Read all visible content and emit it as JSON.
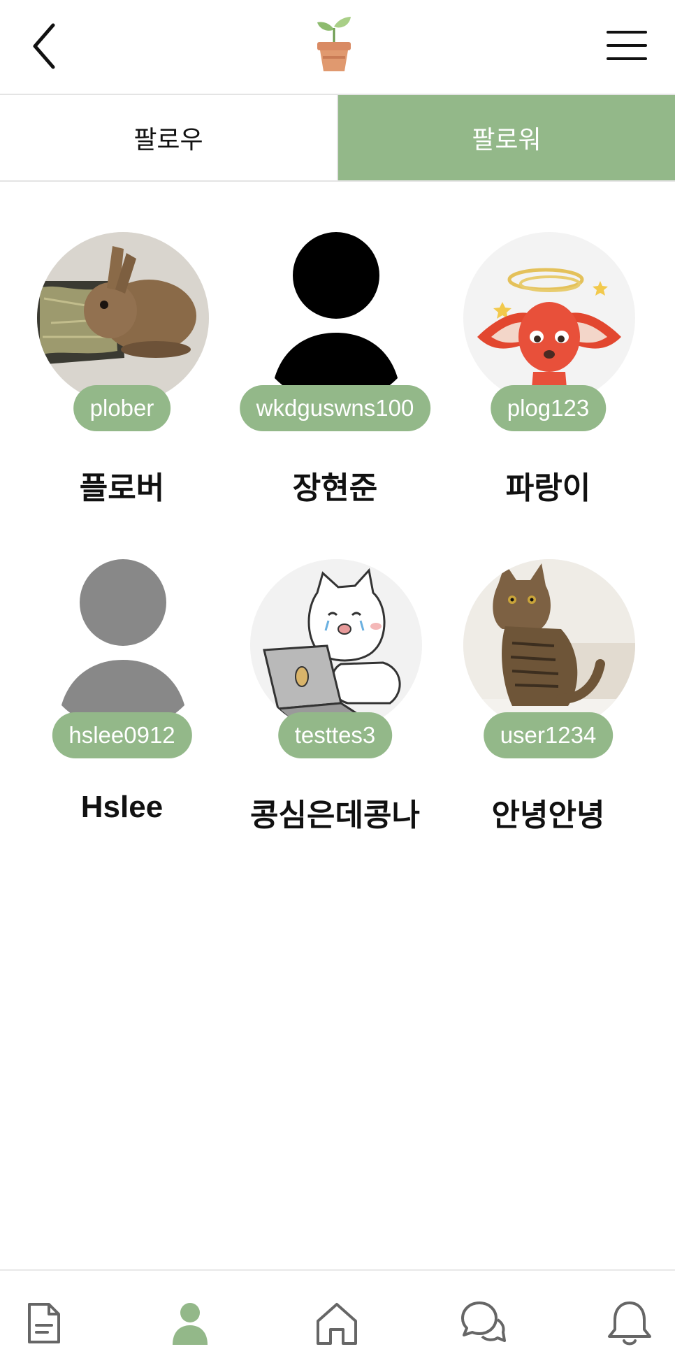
{
  "header": {
    "back_icon": "chevron-left-icon",
    "logo_icon": "sprout-pot-icon",
    "menu_icon": "hamburger-menu-icon"
  },
  "tabs": [
    {
      "label": "팔로우",
      "active": false
    },
    {
      "label": "팔로워",
      "active": true
    }
  ],
  "followers": [
    {
      "id": "plober",
      "name": "플로버",
      "avatar": "rabbit-photo"
    },
    {
      "id": "wkdguswns100",
      "name": "장현준",
      "avatar": "default-person-black"
    },
    {
      "id": "plog123",
      "name": "파랑이",
      "avatar": "cartoon-fox-dizzy"
    },
    {
      "id": "hslee0912",
      "name": "Hslee",
      "avatar": "default-person-gray"
    },
    {
      "id": "testtes3",
      "name": "콩심은데콩나",
      "avatar": "cartoon-cat-laptop"
    },
    {
      "id": "user1234",
      "name": "안녕안녕",
      "avatar": "tabby-cat-photo"
    }
  ],
  "colors": {
    "accent": "#93b889",
    "text": "#111111",
    "divider": "#e4e4e4"
  },
  "bottom_nav": [
    {
      "icon": "document-icon",
      "active": false
    },
    {
      "icon": "person-icon",
      "active": true
    },
    {
      "icon": "home-icon",
      "active": false
    },
    {
      "icon": "chat-icon",
      "active": false
    },
    {
      "icon": "bell-icon",
      "active": false
    }
  ]
}
